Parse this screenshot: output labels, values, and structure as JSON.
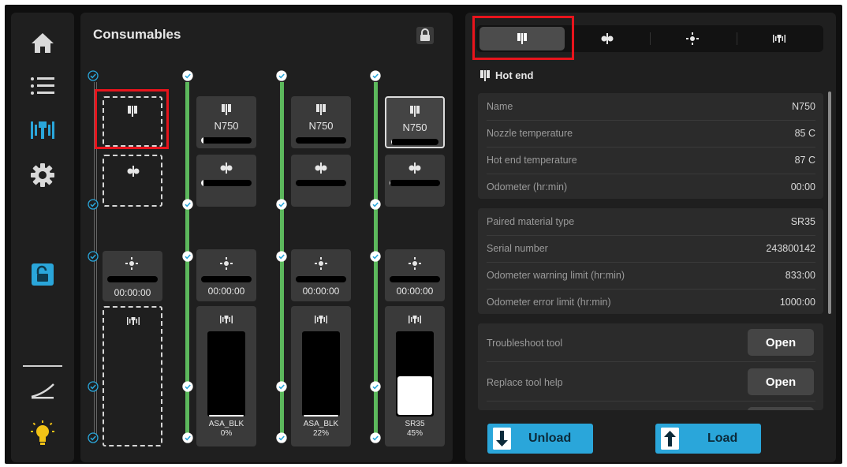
{
  "sidebar": {
    "items": [
      {
        "name": "home-icon"
      },
      {
        "name": "list-icon"
      },
      {
        "name": "material-bays-icon"
      },
      {
        "name": "gear-icon"
      },
      {
        "name": "unlock-icon"
      },
      {
        "name": "bed-level-icon"
      },
      {
        "name": "light-bulb-icon"
      }
    ]
  },
  "consumables": {
    "title": "Consumables",
    "lock_icon": "lock-icon",
    "bays": [
      {
        "nozzle_label": "",
        "hotend_progress": 0,
        "timer": "00:00:00",
        "material": "",
        "percent": "",
        "fill": 0
      },
      {
        "nozzle_label": "N750",
        "hotend_progress": 0.04,
        "timer": "00:00:00",
        "material": "ASA_BLK",
        "percent": "0%",
        "fill": 0.0
      },
      {
        "nozzle_label": "N750",
        "hotend_progress": 0,
        "timer": "00:00:00",
        "material": "ASA_BLK",
        "percent": "22%",
        "fill": 0.02
      },
      {
        "nozzle_label": "N750",
        "hotend_progress": 0.01,
        "timer": "00:00:00",
        "material": "SR35",
        "percent": "45%",
        "fill": 0.45
      }
    ]
  },
  "tabs": [
    {
      "icon": "hot-end-icon",
      "active": true
    },
    {
      "icon": "spool-holder-icon",
      "active": false
    },
    {
      "icon": "uv-light-icon",
      "active": false
    },
    {
      "icon": "material-bay-icon",
      "active": false
    }
  ],
  "details": {
    "section_title": "Hot end",
    "group1": [
      {
        "key": "Name",
        "value": "N750"
      },
      {
        "key": "Nozzle temperature",
        "value": "85 C"
      },
      {
        "key": "Hot end temperature",
        "value": "87 C"
      },
      {
        "key": "Odometer (hr:min)",
        "value": "00:00"
      }
    ],
    "group2": [
      {
        "key": "Paired material type",
        "value": "SR35"
      },
      {
        "key": "Serial number",
        "value": "243800142"
      },
      {
        "key": "Odometer warning limit (hr:min)",
        "value": "833:00"
      },
      {
        "key": "Odometer error limit (hr:min)",
        "value": "1000:00"
      }
    ],
    "actions": [
      {
        "label": "Troubleshoot tool",
        "button": "Open"
      },
      {
        "label": "Replace tool help",
        "button": "Open"
      }
    ]
  },
  "footer": {
    "unload": "Unload",
    "load": "Load"
  },
  "colors": {
    "accent": "#2aa6da",
    "active_line": "#5cb85c",
    "highlight": "#e8141c",
    "check": "#2aa6da"
  }
}
